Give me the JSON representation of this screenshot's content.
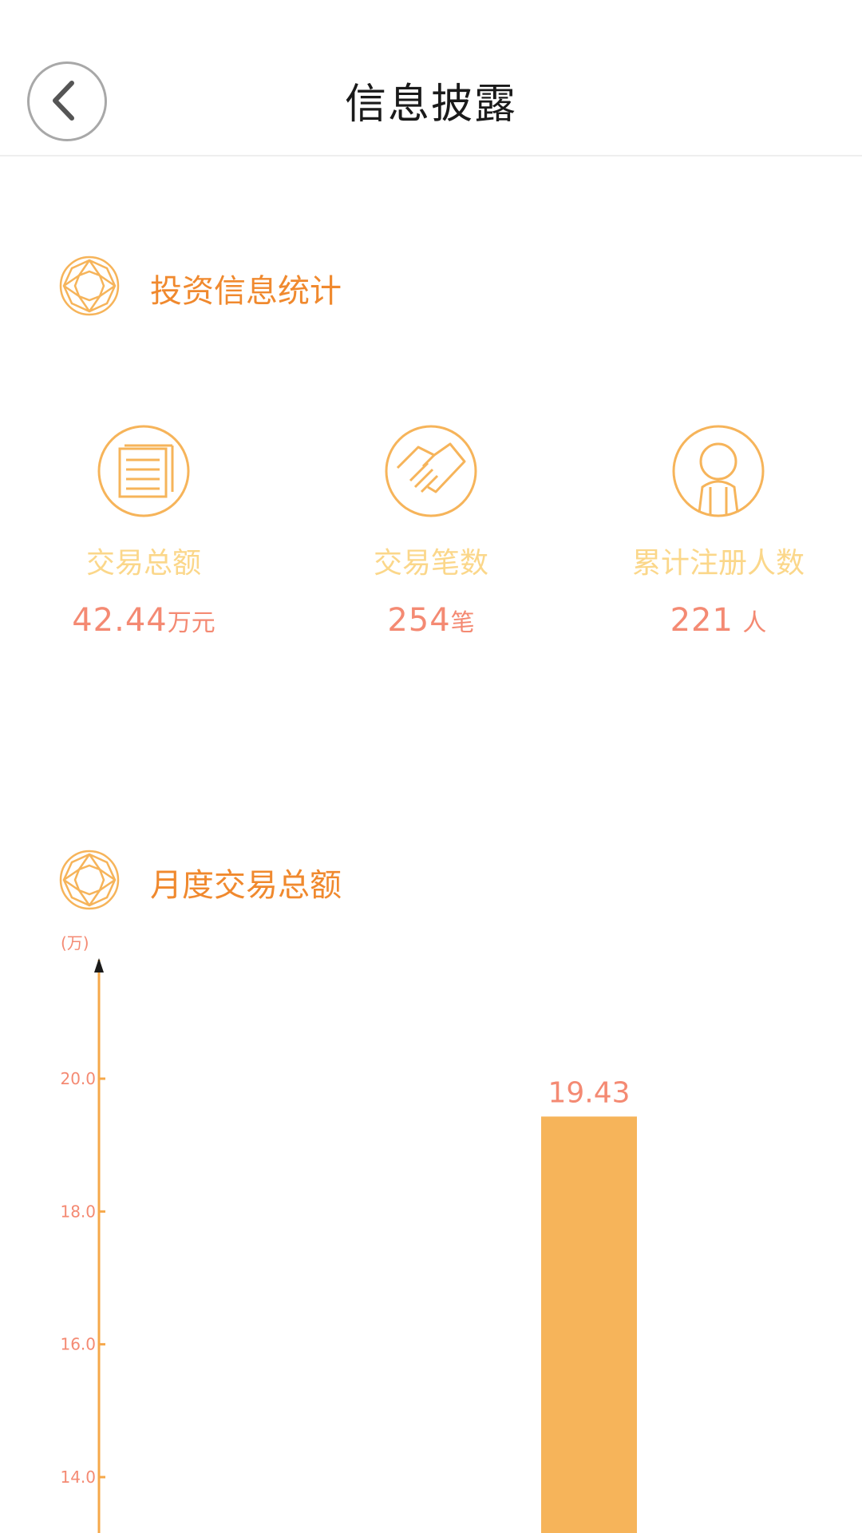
{
  "header": {
    "title": "信息披露",
    "back_icon": "chevron-left-icon"
  },
  "section_stats": {
    "title": "投资信息统计",
    "icon": "diamond-icon"
  },
  "stats": [
    {
      "icon": "documents-icon",
      "label": "交易总额",
      "value": "42.44",
      "unit": "万元"
    },
    {
      "icon": "handshake-icon",
      "label": "交易笔数",
      "value": "254",
      "unit": "笔"
    },
    {
      "icon": "user-icon",
      "label": "累计注册人数",
      "value": "221",
      "unit": "人"
    }
  ],
  "section_chart": {
    "title": "月度交易总额",
    "icon": "diamond-icon"
  },
  "colors": {
    "accent": "#f0892e",
    "bar": "#f6b45a",
    "axis": "#f6a84a",
    "value_text": "#f48a73",
    "stat_label": "#fbd78a"
  },
  "chart_data": {
    "type": "bar",
    "ylabel": "(万)",
    "yticks": [
      "14.0",
      "16.0",
      "18.0",
      "20.0"
    ],
    "ylim": [
      12.0,
      21.0
    ],
    "categories": [
      ""
    ],
    "values": [
      19.43
    ],
    "data_labels": [
      "19.43"
    ],
    "grid": false
  }
}
